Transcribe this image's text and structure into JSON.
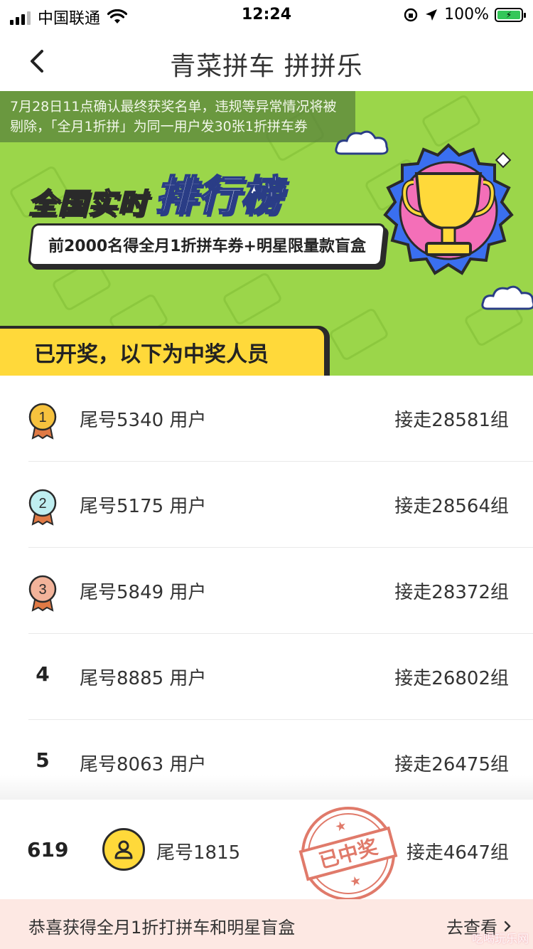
{
  "status_bar": {
    "carrier": "中国联通",
    "time": "12:24",
    "battery": "100%"
  },
  "nav": {
    "title": "青菜拼车 拼拼乐"
  },
  "banner": {
    "notice": "7月28日11点确认最终获奖名单，违规等异常情况将被剔除，「全月1折拼」为同一用户发30张1折拼车券",
    "title_part1": "全国实时",
    "title_part2": "排行榜",
    "prize": "前2000名得全月1折拼车券+明星限量款盲盒",
    "winner_tab": "已开奖，以下为中奖人员"
  },
  "rankings": [
    {
      "rank": "1",
      "name": "尾号5340 用户",
      "score": "接走28581组",
      "medal": "gold"
    },
    {
      "rank": "2",
      "name": "尾号5175 用户",
      "score": "接走28564组",
      "medal": "silver"
    },
    {
      "rank": "3",
      "name": "尾号5849 用户",
      "score": "接走28372组",
      "medal": "bronze"
    },
    {
      "rank": "4",
      "name": "尾号8885 用户",
      "score": "接走26802组"
    },
    {
      "rank": "5",
      "name": "尾号8063 用户",
      "score": "接走26475组"
    }
  ],
  "my_row": {
    "rank": "619",
    "name": "尾号1815",
    "score": "接走4647组",
    "stamp": "已中奖"
  },
  "bottom_bar": {
    "text": "恭喜获得全月1折打拼车和明星盲盒",
    "link": "去查看"
  },
  "watermark": "吃喝玩乐网",
  "colors": {
    "banner_green": "#9bd64a",
    "accent_yellow": "#ffd93a",
    "stamp_red": "#e07a6a",
    "bottom_bg": "#fde8e3"
  }
}
